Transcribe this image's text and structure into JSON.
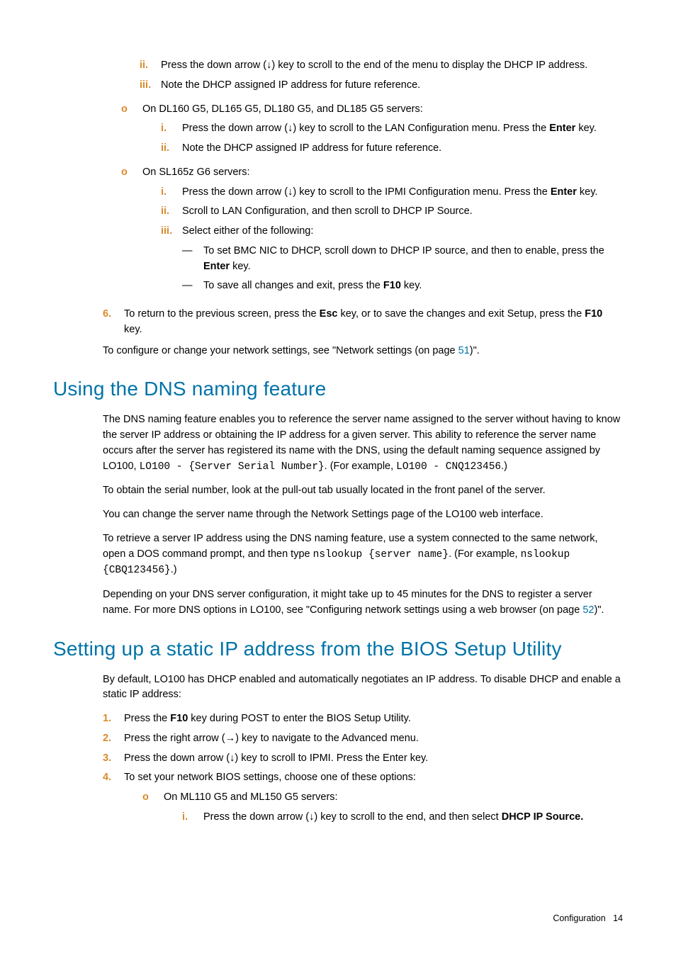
{
  "top": {
    "sub_ii_pre": "Press the down arrow (",
    "sub_ii_post": ") key to scroll to the end of the menu to display the DHCP IP address.",
    "sub_iii": "Note the DHCP assigned IP address for future reference.",
    "bullet2": "On DL160 G5, DL165 G5, DL180 G5, and DL185 G5 servers:",
    "b2_i_pre": "Press the down arrow (",
    "b2_i_mid": ") key to scroll to the LAN Configuration menu. Press the ",
    "b2_i_bold": "Enter",
    "b2_i_post": " key.",
    "b2_ii": "Note the DHCP assigned IP address for future reference.",
    "bullet3": "On SL165z G6 servers:",
    "b3_i_pre": "Press the down arrow (",
    "b3_i_mid": ") key to scroll to the IPMI Configuration menu. Press the ",
    "b3_i_bold": "Enter",
    "b3_i_post": " key.",
    "b3_ii": "Scroll to LAN Configuration, and then scroll to DHCP IP Source.",
    "b3_iii": "Select either of the following:",
    "b3_dash1_pre": "To set BMC NIC to DHCP, scroll down to DHCP IP source, and then to enable, press the ",
    "b3_dash1_bold": "Enter",
    "b3_dash1_post": " key.",
    "b3_dash2_pre": "To save all changes and exit, press the ",
    "b3_dash2_bold": "F10",
    "b3_dash2_post": " key.",
    "step6_pre": "To return to the previous screen, press the ",
    "step6_bold1": "Esc",
    "step6_mid": " key, or to save the changes and exit Setup, press the ",
    "step6_bold2": "F10",
    "step6_post": " key.",
    "para_netset_pre": "To configure or change your network settings, see \"Network settings (on page ",
    "para_netset_link": "51",
    "para_netset_post": ")\"."
  },
  "markers": {
    "ii": "ii.",
    "iii": "iii.",
    "i": "i.",
    "six": "6.",
    "one": "1.",
    "two": "2.",
    "three": "3.",
    "four": "4.",
    "circle": "o",
    "dash": "—"
  },
  "arrows": {
    "down": "↓",
    "right": "→"
  },
  "h_dns": "Using the DNS naming feature",
  "dns": {
    "p1_a": "The DNS naming feature enables you to reference the server name assigned to the server without having to know the server IP address or obtaining the IP address for a given server. This ability to reference the server name occurs after the server has registered its name with the DNS, using the default naming sequence assigned by LO100, ",
    "p1_mono1": "LO100 - {Server Serial Number}",
    "p1_b": ". (For example, ",
    "p1_mono2": "LO100 - CNQ123456",
    "p1_c": ".)",
    "p2": "To obtain the serial number, look at the pull-out tab usually located in the front panel of the server.",
    "p3": "You can change the server name through the Network Settings page of the LO100 web interface.",
    "p4_a": "To retrieve a server IP address using the DNS naming feature, use a system connected to the same network, open a DOS command prompt, and then type ",
    "p4_mono1": "nslookup {server name}",
    "p4_b": ". (For example, ",
    "p4_mono2": "nslookup {CBQ123456}",
    "p4_c": ".)",
    "p5_a": "Depending on your DNS server configuration, it might take up to 45 minutes for the DNS to register a server name. For more DNS options in LO100, see \"Configuring network settings using a web browser (on page ",
    "p5_link": "52",
    "p5_b": ")\"."
  },
  "h_static": "Setting up a static IP address from the BIOS Setup Utility",
  "static": {
    "p1": "By default, LO100 has DHCP enabled and automatically negotiates an IP address. To disable DHCP and enable a static IP address:",
    "s1_pre": "Press the ",
    "s1_bold": "F10",
    "s1_post": " key during POST to enter the BIOS Setup Utility.",
    "s2_pre": "Press the right arrow (",
    "s2_post": ") key to navigate to the Advanced menu.",
    "s3_pre": "Press the down arrow (",
    "s3_post": ") key to scroll to IPMI. Press the Enter key.",
    "s4": "To set your network BIOS settings, choose one of these options:",
    "s4_bullet": "On ML110 G5 and ML150 G5 servers:",
    "s4_i_pre": "Press the down arrow (",
    "s4_i_mid": ") key to scroll to the end, and then select ",
    "s4_i_bold": "DHCP IP Source."
  },
  "footer": {
    "section": "Configuration",
    "page": "14"
  }
}
